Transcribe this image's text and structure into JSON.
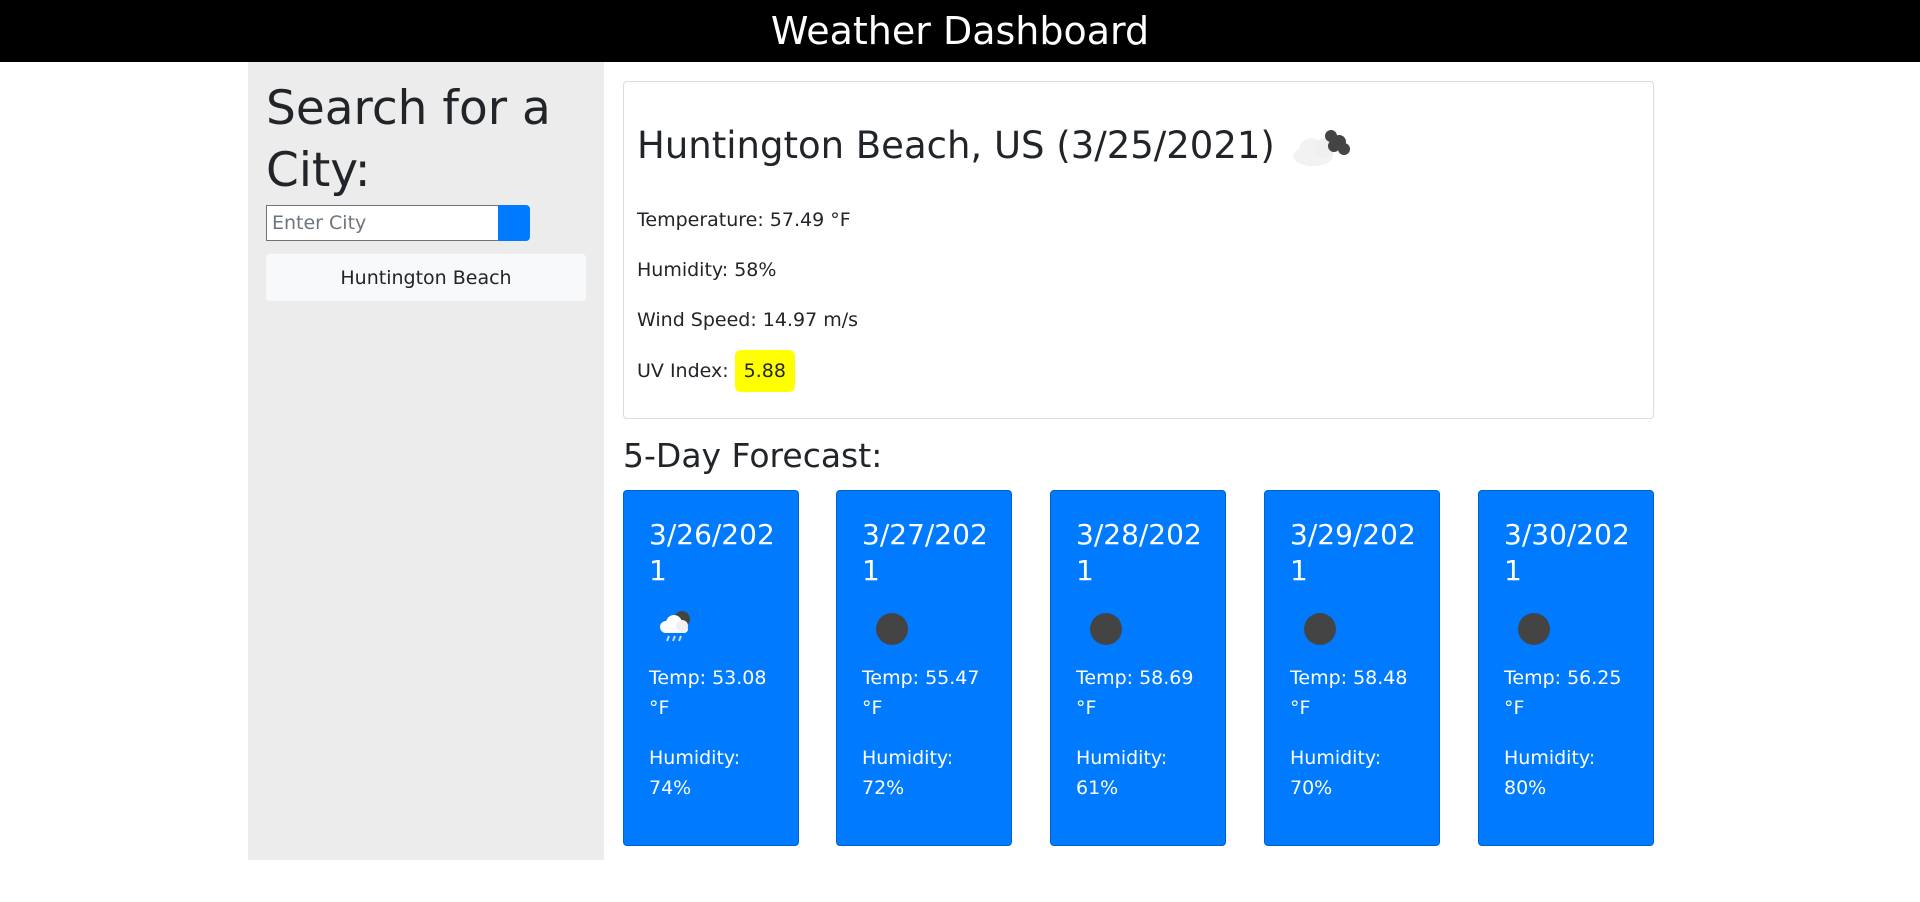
{
  "header": {
    "title": "Weather Dashboard"
  },
  "sidebar": {
    "heading": "Search for a City:",
    "search": {
      "placeholder": "Enter City",
      "value": ""
    },
    "history": [
      {
        "label": "Huntington Beach"
      }
    ]
  },
  "current": {
    "title": "Huntington Beach, US (3/25/2021)",
    "icon": "cloud-icon",
    "temperature": "Temperature: 57.49 °F",
    "humidity": "Humidity: 58%",
    "wind": "Wind Speed: 14.97 m/s",
    "uv_label": "UV Index:",
    "uv_value": "5.88",
    "uv_color": "#ffff00"
  },
  "forecast": {
    "title": "5-Day Forecast:",
    "accent": "#007bff",
    "days": [
      {
        "date": "3/26/2021",
        "icon": "rain-cloud-icon",
        "temp": "Temp: 53.08 °F",
        "humidity": "Humidity: 74%"
      },
      {
        "date": "3/27/2021",
        "icon": "moon-icon",
        "temp": "Temp: 55.47 °F",
        "humidity": "Humidity: 72%"
      },
      {
        "date": "3/28/2021",
        "icon": "moon-icon",
        "temp": "Temp: 58.69 °F",
        "humidity": "Humidity: 61%"
      },
      {
        "date": "3/29/2021",
        "icon": "moon-icon",
        "temp": "Temp: 58.48 °F",
        "humidity": "Humidity: 70%"
      },
      {
        "date": "3/30/2021",
        "icon": "moon-icon",
        "temp": "Temp: 56.25 °F",
        "humidity": "Humidity: 80%"
      }
    ]
  }
}
